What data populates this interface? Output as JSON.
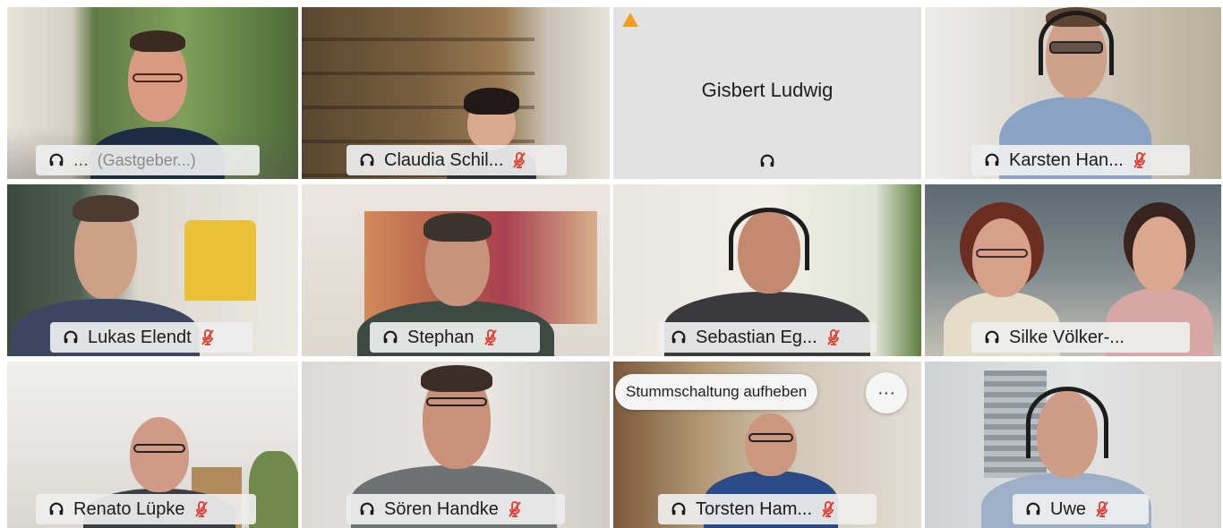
{
  "participants": [
    {
      "name": "(Gastgeber...)",
      "prefix": "...",
      "host": true
    },
    {
      "name": "Claudia Schil..."
    },
    {
      "name": "Gisbert Ludwig"
    },
    {
      "name": "Karsten Han..."
    },
    {
      "name": "Lukas Elendt"
    },
    {
      "name": "Stephan"
    },
    {
      "name": "Sebastian Eg..."
    },
    {
      "name": "Silke Völker-..."
    },
    {
      "name": "Renato Lüpke"
    },
    {
      "name": "Sören Handke"
    },
    {
      "name": "Torsten Ham..."
    },
    {
      "name": "Uwe"
    }
  ],
  "controls": {
    "unmute_label": "Stummschaltung aufheben",
    "more_label": "···"
  },
  "colors": {
    "active_border": "#2fa6d6",
    "mic_off": "#e0453a",
    "warning": "#f0a020"
  }
}
